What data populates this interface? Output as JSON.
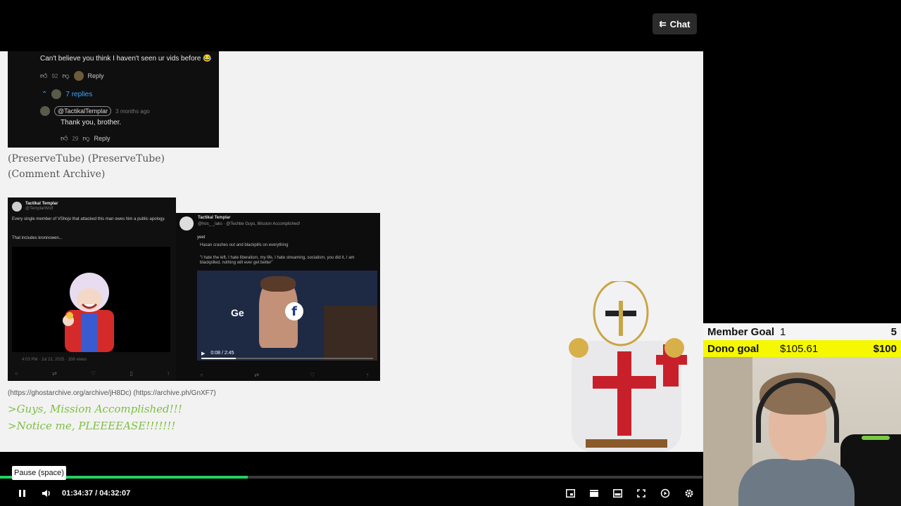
{
  "chat_button": {
    "label": "Chat",
    "icon": "chat-list-icon"
  },
  "youtube_comment": {
    "comment_text": "Can't believe you think I haven't seen ur vids before 😂",
    "likes": "92",
    "reply_label": "Reply",
    "replies_toggle": "7 replies",
    "reply_handle": "@TactikalTemplar",
    "reply_time": "3 months ago",
    "reply_text": "Thank you, brother.",
    "reply_likes": "29",
    "reply_label_2": "Reply"
  },
  "source_links": {
    "line1": "(PreserveTube) (PreserveTube)",
    "line2": "(Comment Archive)"
  },
  "tweet1": {
    "author": "Tactikal Templar",
    "handle": "@TemplarWolf",
    "body": "Every single member of VShojo that attacked this man owes him a public apology.",
    "body2": "That includes kronnowen...",
    "meta": "4:03 PM · Jul 22, 2025 · 338 views"
  },
  "tweet2": {
    "author": "Tactikal Templar",
    "reply_line": "@hos_ _laks · @Teshbe Guys, Mission Accomplished!",
    "quote_author": "yeet",
    "quote_line1": "Hasan crashes out and blackpills on everything",
    "quote_line2": "\"I hate the left, I hate liberalism, my life, I hate streaming, socialism, you did it, I am blackpilled, nothing will ever get better\"",
    "video_time": "0:08 / 2:45",
    "overlay_text": "Ge"
  },
  "archive_links": "(https://ghostarchive.org/archive/jH8Dc) (https://archive.ph/GnXF7)",
  "greentext": {
    "line1": ">Guys, Mission Accomplished!!!",
    "line2": ">Notice me, PLEEEEASE!!!!!!!"
  },
  "member_goal": {
    "label": "Member Goal",
    "current": "1",
    "target": "5"
  },
  "dono_goal": {
    "label": "Dono goal",
    "current": "$105.61",
    "target": "$100"
  },
  "player": {
    "tooltip": "Pause (space)",
    "time": "01:34:37 / 04:32:07",
    "progress_fraction": 0.353,
    "progress_color": "#23d160"
  },
  "colors": {
    "goal_yellow": "#f5f800",
    "greentext": "#7dbf3f"
  }
}
